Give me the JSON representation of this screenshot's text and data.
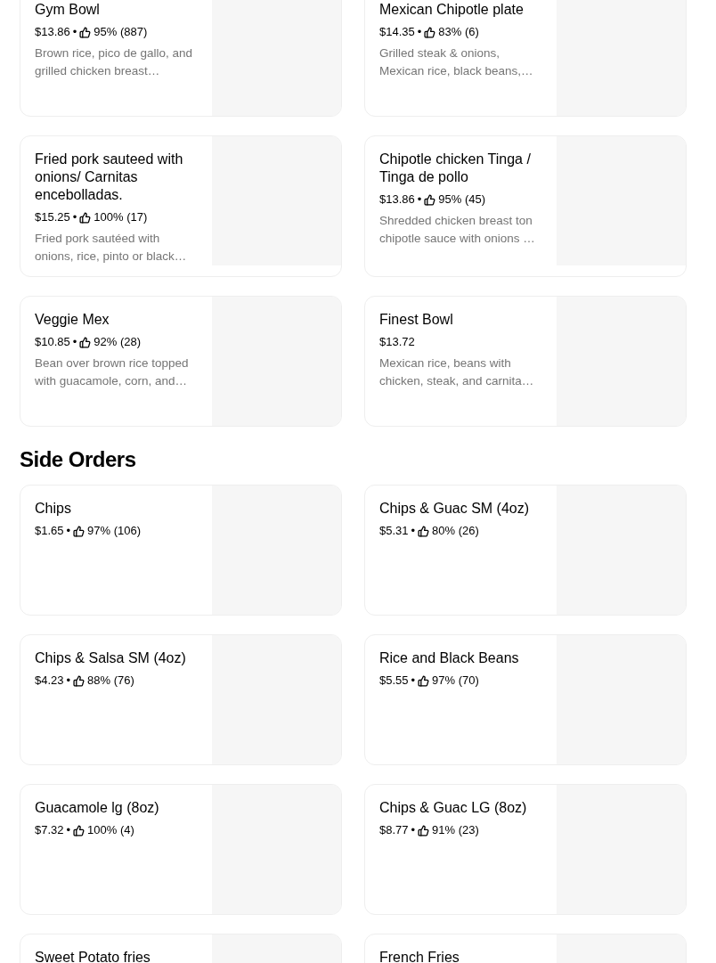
{
  "sections": [
    {
      "items": [
        {
          "name": "Gym Bowl",
          "price": "$13.86",
          "separator": "•",
          "rating": "95% (887)",
          "description": "Brown rice, pico de gallo, and grilled chicken breast…"
        },
        {
          "name": "Mexican Chipotle plate",
          "price": "$14.35",
          "separator": "•",
          "rating": "83% (6)",
          "description": "Grilled steak & onions, Mexican rice, black beans,…"
        },
        {
          "name": "Fried pork sauteed with onions/ Carnitas encebolladas.",
          "price": "$15.25",
          "separator": "•",
          "rating": "100% (17)",
          "description": "Fried pork sautéed with onions, rice, pinto or black…"
        },
        {
          "name": "Chipotle chicken Tinga / Tinga de pollo",
          "price": "$13.86",
          "separator": "•",
          "rating": "95% (45)",
          "description": "Shredded chicken breast ton chipotle sauce with onions …"
        },
        {
          "name": "Veggie Mex",
          "price": "$10.85",
          "separator": "•",
          "rating": "92% (28)",
          "description": "Bean over brown rice topped with guacamole, corn, and…"
        },
        {
          "name": "Finest Bowl",
          "price": "$13.72",
          "description": "Mexican rice, beans with chicken, steak, and carnita…"
        }
      ]
    },
    {
      "title": "Side Orders",
      "items": [
        {
          "name": "Chips",
          "price": "$1.65",
          "separator": "•",
          "rating": "97% (106)"
        },
        {
          "name": "Chips & Guac SM (4oz)",
          "price": "$5.31",
          "separator": "•",
          "rating": "80% (26)"
        },
        {
          "name": "Chips & Salsa SM (4oz)",
          "price": "$4.23",
          "separator": "•",
          "rating": "88% (76)"
        },
        {
          "name": "Rice and Black Beans",
          "price": "$5.55",
          "separator": "•",
          "rating": "97% (70)"
        },
        {
          "name": "Guacamole lg (8oz)",
          "price": "$7.32",
          "separator": "•",
          "rating": "100% (4)"
        },
        {
          "name": "Chips & Guac LG (8oz)",
          "price": "$8.77",
          "separator": "•",
          "rating": "91% (23)"
        },
        {
          "name": "Sweet Potato fries"
        },
        {
          "name": "French Fries"
        }
      ]
    }
  ]
}
